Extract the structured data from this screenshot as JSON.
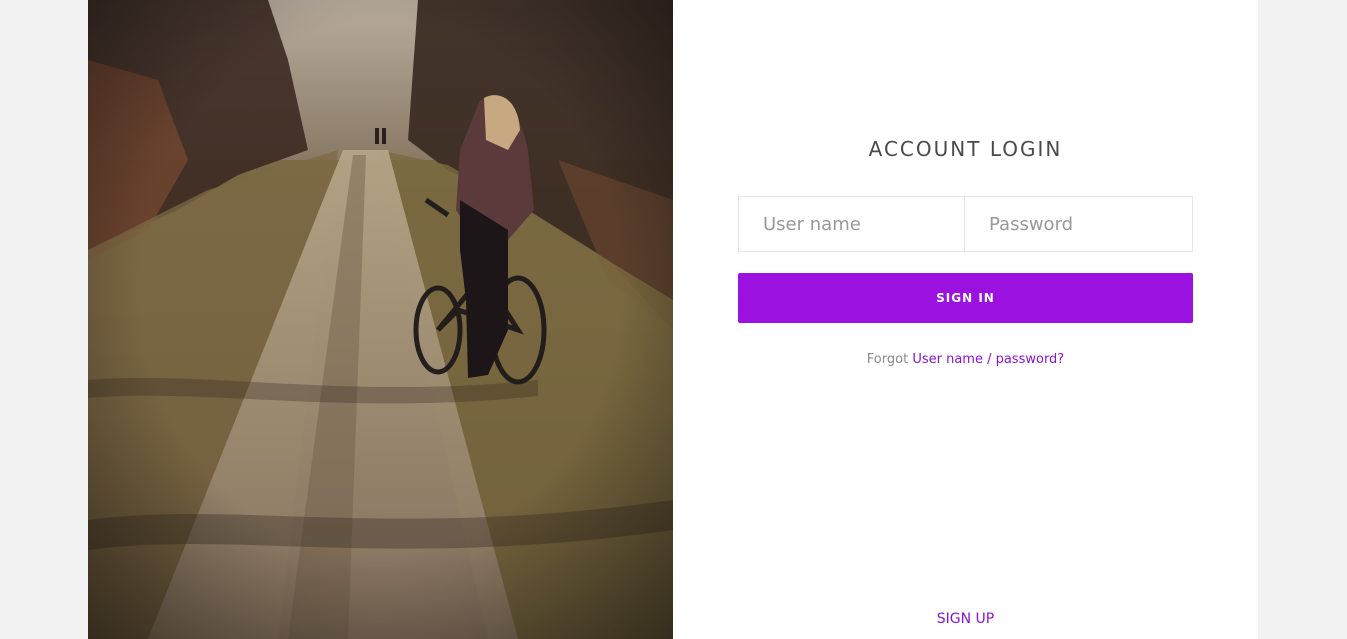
{
  "login": {
    "title": "ACCOUNT LOGIN",
    "username_placeholder": "User name",
    "password_placeholder": "Password",
    "signin_label": "SIGN IN",
    "forgot_prefix": "Forgot",
    "forgot_link": "User name / password?",
    "signup_label": "SIGN UP"
  },
  "colors": {
    "accent": "#9b12e0",
    "link": "#8a14d6",
    "page_bg": "#f2f2f2",
    "card_bg": "#ffffff"
  }
}
